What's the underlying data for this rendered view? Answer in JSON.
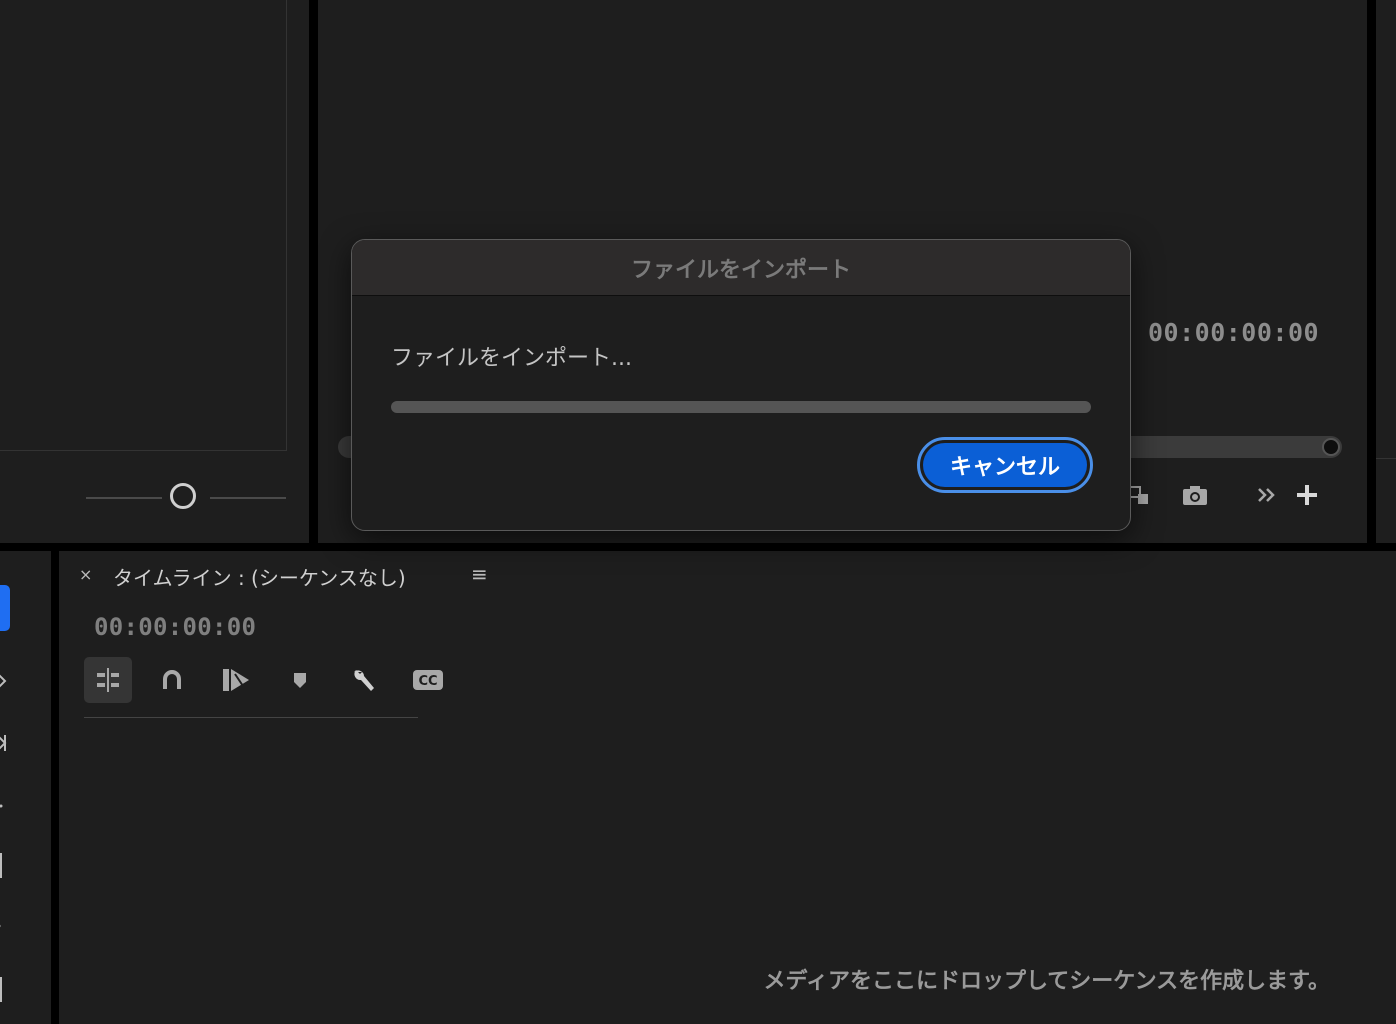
{
  "import_dialog": {
    "title": "ファイルをインポート",
    "message": "ファイルをインポート...",
    "progress": 0,
    "cancel_label": "キャンセル"
  },
  "monitor": {
    "timecode": "00:00:00:00",
    "icons": [
      "export-frame-icon",
      "camera-icon",
      "chevron-double-right-icon",
      "plus-icon"
    ]
  },
  "timeline": {
    "close_glyph": "×",
    "title": "タイムライン : (シーケンスなし)",
    "menu_glyph": "≡",
    "timecode": "00:00:00:00",
    "tools": [
      "insert-sequence-icon",
      "snap-magnet-icon",
      "linked-selection-icon",
      "marker-icon",
      "wrench-icon",
      "closed-caption-icon"
    ],
    "drop_message": "メディアをここにドロップしてシーケンスを作成します。"
  },
  "colors": {
    "accent": "#0b5fd6",
    "panel_bg": "#1e1e1e",
    "frame": "#000000"
  }
}
